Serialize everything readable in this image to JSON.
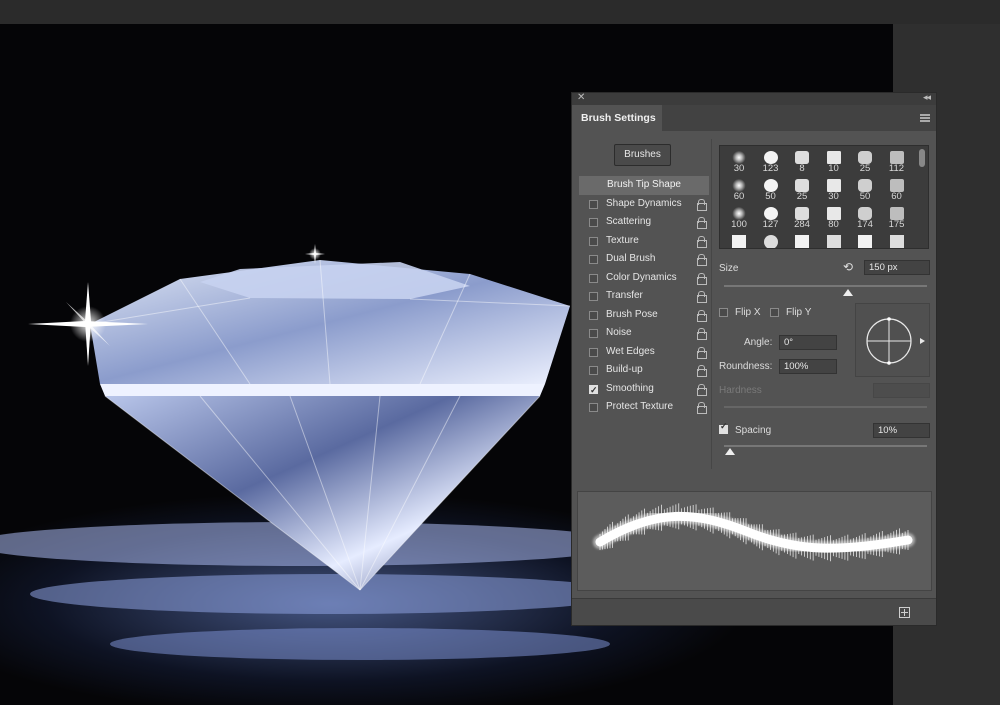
{
  "panel": {
    "title": "Brush Settings",
    "brushes_button": "Brushes"
  },
  "options": [
    {
      "label": "Brush Tip Shape",
      "header": true
    },
    {
      "label": "Shape Dynamics",
      "checked": false
    },
    {
      "label": "Scattering",
      "checked": false
    },
    {
      "label": "Texture",
      "checked": false
    },
    {
      "label": "Dual Brush",
      "checked": false
    },
    {
      "label": "Color Dynamics",
      "checked": false
    },
    {
      "label": "Transfer",
      "checked": false
    },
    {
      "label": "Brush Pose",
      "checked": false
    },
    {
      "label": "Noise",
      "checked": false
    },
    {
      "label": "Wet Edges",
      "checked": false
    },
    {
      "label": "Build-up",
      "checked": false
    },
    {
      "label": "Smoothing",
      "checked": true
    },
    {
      "label": "Protect Texture",
      "checked": false
    }
  ],
  "presets": [
    [
      "30",
      "123",
      "8",
      "10",
      "25",
      "112"
    ],
    [
      "60",
      "50",
      "25",
      "30",
      "50",
      "60"
    ],
    [
      "100",
      "127",
      "284",
      "80",
      "174",
      "175"
    ]
  ],
  "size": {
    "label": "Size",
    "value": "150 px"
  },
  "flip": {
    "flip_x": "Flip X",
    "flip_y": "Flip Y"
  },
  "angle": {
    "label": "Angle:",
    "value": "0°"
  },
  "roundness": {
    "label": "Roundness:",
    "value": "100%"
  },
  "hardness": {
    "label": "Hardness"
  },
  "spacing": {
    "label": "Spacing",
    "value": "10%",
    "checked": true
  }
}
